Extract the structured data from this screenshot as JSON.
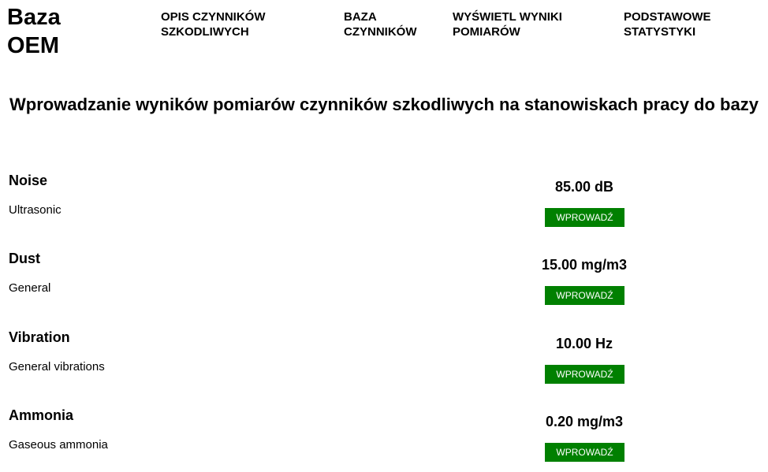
{
  "header": {
    "brand": "Baza OEM",
    "nav": [
      {
        "label": "OPIS CZYNNIKÓW SZKODLIWYCH"
      },
      {
        "label": "BAZA CZYNNIKÓW"
      },
      {
        "label": "WYŚWIETL WYNIKI POMIARÓW"
      },
      {
        "label": "PODSTAWOWE STATYSTYKI"
      }
    ]
  },
  "main": {
    "title": "Wprowadzanie wyników pomiarów czynników szkodliwych na stanowiskach pracy do bazy",
    "rows": [
      {
        "name": "Noise",
        "description": "Ultrasonic",
        "value": "85.00 dB",
        "button": "WPROWADŹ"
      },
      {
        "name": "Dust",
        "description": "General",
        "value": "15.00 mg/m3",
        "button": "WPROWADŹ"
      },
      {
        "name": "Vibration",
        "description": "General vibrations",
        "value": "10.00 Hz",
        "button": "WPROWADŹ"
      },
      {
        "name": "Ammonia",
        "description": "Gaseous ammonia",
        "value": "0.20 mg/m3",
        "button": "WPROWADŹ"
      }
    ]
  },
  "colors": {
    "button_bg": "#008000",
    "button_text": "#ffffff"
  }
}
